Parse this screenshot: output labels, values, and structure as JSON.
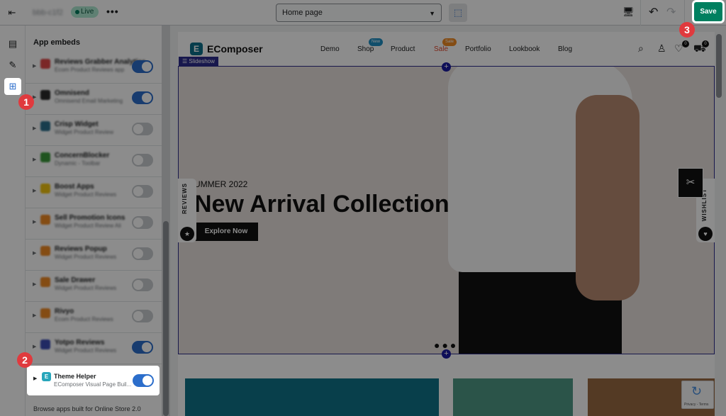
{
  "topbar": {
    "store_name": "bbb-c1f2",
    "status": "Live",
    "more": "•••",
    "page_select": "Home page",
    "save_label": "Save"
  },
  "panel": {
    "title": "App embeds",
    "apps": [
      {
        "name": "Reviews Grabber Analytics",
        "sub": "Ecom Product Reviews app",
        "on": true,
        "color": "#e04848"
      },
      {
        "name": "Omnisend",
        "sub": "Omnisend Email Marketing",
        "on": true,
        "color": "#2b2b2b"
      },
      {
        "name": "Crisp Widget",
        "sub": "Widget Product Review",
        "on": false,
        "color": "#2a6f8c"
      },
      {
        "name": "ConcernBlocker",
        "sub": "Dynamic - Toolbar",
        "on": false,
        "color": "#3b9a3b"
      },
      {
        "name": "Boost Apps",
        "sub": "Widget Product Reviews",
        "on": false,
        "color": "#f1c40f"
      },
      {
        "name": "Sell Promotion Icons",
        "sub": "Widget Product Review Ali",
        "on": false,
        "color": "#f08a24"
      },
      {
        "name": "Reviews Popup",
        "sub": "Widget Product Reviews",
        "on": false,
        "color": "#f08a24"
      },
      {
        "name": "Sale Drawer",
        "sub": "Widget Product Reviews",
        "on": false,
        "color": "#f08a24"
      },
      {
        "name": "Rivyo",
        "sub": "Ecom Product Reviews",
        "on": false,
        "color": "#f08a24"
      },
      {
        "name": "Yotpo Reviews",
        "sub": "Widget Product Reviews",
        "on": true,
        "color": "#3d4db5"
      }
    ],
    "highlight": {
      "name": "Theme Helper",
      "sub": "EComposer Visual Page Buil..."
    },
    "browse": "Browse apps built for Online Store 2.0"
  },
  "site": {
    "brand": "EComposer",
    "nav": [
      "Demo",
      "Shop",
      "Product",
      "Sale",
      "Portfolio",
      "Lookbook",
      "Blog"
    ],
    "badge_new": "New",
    "badge_sale": "Sale",
    "wishlist_count": "0",
    "cart_count": "0",
    "section_tag": "Slideshow",
    "hero_sub": "UMMER 2022",
    "hero_title": "New Arrival Collection",
    "hero_btn": "Explore Now",
    "reviews_label": "REVIEWS",
    "wishlist_label": "WISHLIST",
    "recaptcha_text": "Privacy - Terms"
  },
  "steps": [
    "1",
    "2",
    "3"
  ],
  "colors": {
    "accent": "#2c6ecb",
    "save": "#008060",
    "step": "#e03a3e",
    "slideshow": "#2c2c8c"
  }
}
